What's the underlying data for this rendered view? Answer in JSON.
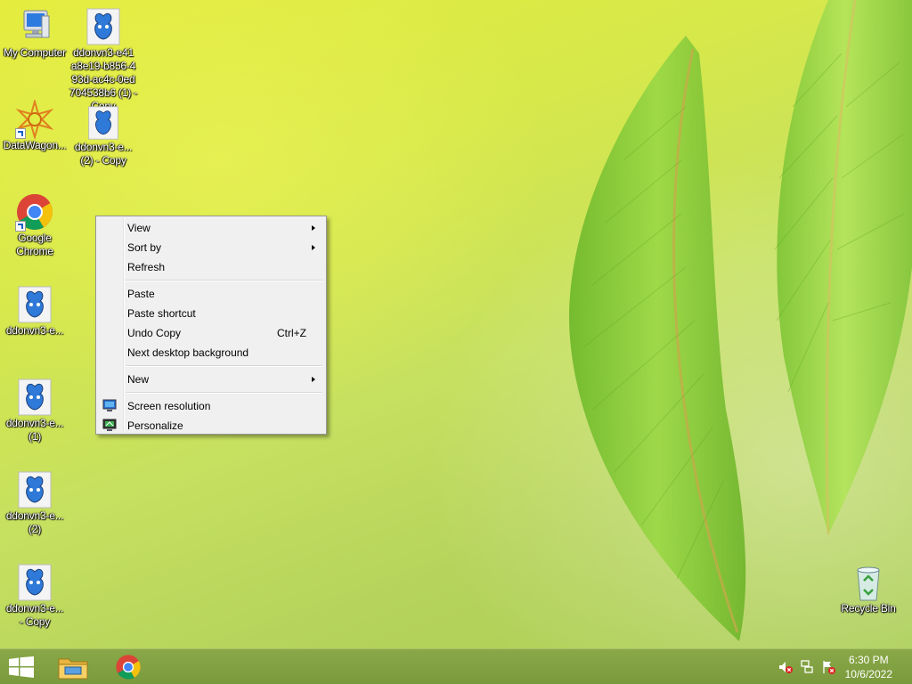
{
  "desktop": {
    "icons": [
      {
        "label": "My Computer"
      },
      {
        "label": "ddonvn3-e41 a8e19-b856-4 93d-ac4c-0ed 704538b6 (1) - Copy"
      },
      {
        "label": "DataWagon..."
      },
      {
        "label": "ddonvn3-e... (2) - Copy"
      },
      {
        "label": "Google Chrome"
      },
      {
        "label": "ddonvn3-e..."
      },
      {
        "label": "ddonvn3-e... (1)"
      },
      {
        "label": "ddonvn3-e... (2)"
      },
      {
        "label": "ddonvn3-e... - Copy"
      },
      {
        "label": "Recycle Bin"
      }
    ]
  },
  "context_menu": {
    "items": [
      {
        "label": "View",
        "submenu": true
      },
      {
        "label": "Sort by",
        "submenu": true
      },
      {
        "label": "Refresh"
      },
      {
        "label": "Paste"
      },
      {
        "label": "Paste shortcut"
      },
      {
        "label": "Undo Copy",
        "shortcut": "Ctrl+Z"
      },
      {
        "label": "Next desktop background"
      },
      {
        "label": "New",
        "submenu": true
      },
      {
        "label": "Screen resolution",
        "icon": "monitor-icon"
      },
      {
        "label": "Personalize",
        "icon": "personalize-monitor-icon"
      }
    ]
  },
  "taskbar": {
    "start": {
      "icon": "windows-logo-icon"
    },
    "pinned": [
      {
        "icon": "file-explorer-icon"
      },
      {
        "icon": "chrome-icon"
      }
    ],
    "tray": [
      {
        "icon": "speaker-muted-icon"
      },
      {
        "icon": "network-icon"
      },
      {
        "icon": "action-center-flag-icon"
      }
    ],
    "clock": {
      "time": "6:30 PM",
      "date": "10/6/2022"
    }
  },
  "colors": {
    "taskbar": "#8aa848",
    "menu_bg": "#f0f0f0",
    "wallpaper_yellow": "#e4ec3c",
    "leaf_green": "#8cc83a"
  }
}
